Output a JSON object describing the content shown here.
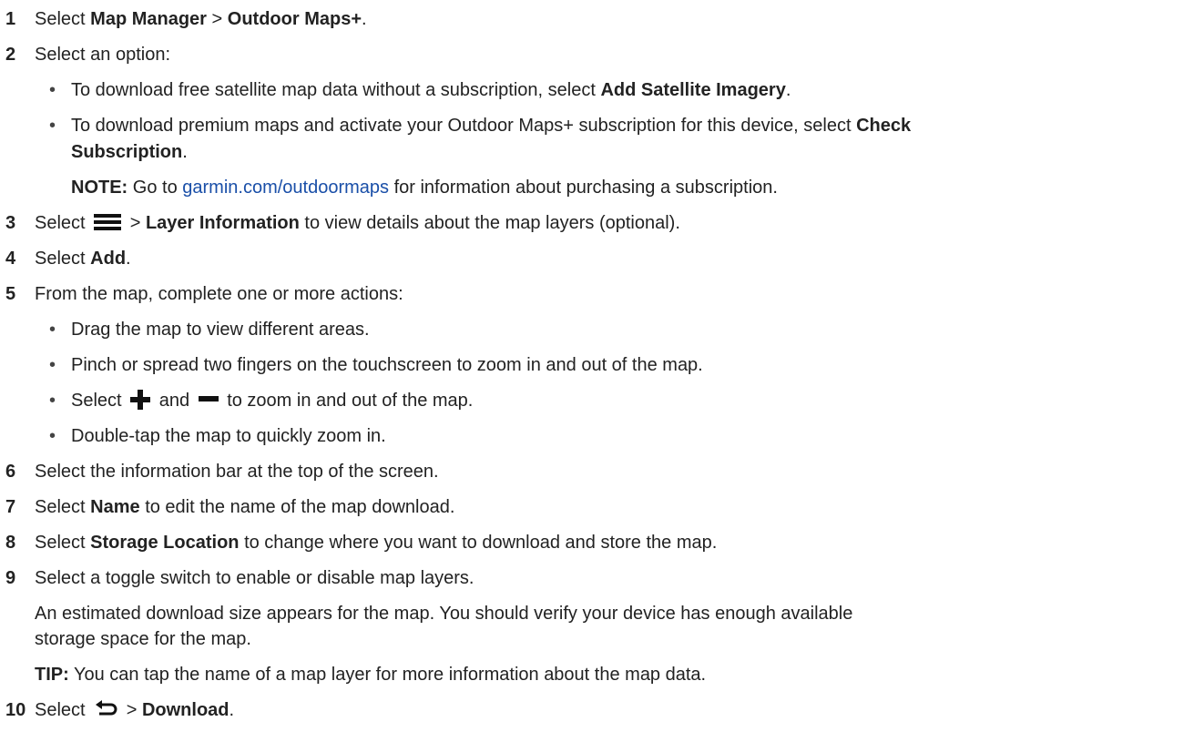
{
  "steps": [
    {
      "num": "1",
      "pre": "Select ",
      "b1": "Map Manager",
      "mid": " > ",
      "b2": "Outdoor Maps+",
      "post": "."
    },
    {
      "num": "2",
      "text": "Select an option:"
    },
    {
      "num": "3",
      "pre": "Select ",
      "mid": " > ",
      "b1": "Layer Information",
      "post": " to view details about the map layers (optional)."
    },
    {
      "num": "4",
      "pre": "Select ",
      "b1": "Add",
      "post": "."
    },
    {
      "num": "5",
      "text": "From the map, complete one or more actions:"
    },
    {
      "num": "6",
      "text": "Select the information bar at the top of the screen."
    },
    {
      "num": "7",
      "pre": "Select ",
      "b1": "Name",
      "post": " to edit the name of the map download."
    },
    {
      "num": "8",
      "pre": "Select ",
      "b1": "Storage Location",
      "post": " to change where you want to download and store the map."
    },
    {
      "num": "9",
      "text": "Select a toggle switch to enable or disable map layers."
    },
    {
      "num": "10",
      "pre": "Select ",
      "mid": " > ",
      "b1": "Download",
      "post": "."
    }
  ],
  "step2_bullets": {
    "b1_pre": "To download free satellite map data without a subscription, select ",
    "b1_bold": "Add Satellite Imagery",
    "b1_post": ".",
    "b2_pre": "To download premium maps and activate your Outdoor Maps+ subscription for this device, select ",
    "b2_bold1": "Check",
    "b2_bold2": "Subscription",
    "b2_post": "."
  },
  "note": {
    "label": "NOTE:",
    "pre": " Go to ",
    "link": "garmin.com/outdoormaps",
    "post": " for information about purchasing a subscription."
  },
  "step5_bullets": {
    "b1": "Drag the map to view different areas.",
    "b2": "Pinch or spread two fingers on the touchscreen to zoom in and out of the map.",
    "b3_pre": "Select ",
    "b3_mid": " and ",
    "b3_post": " to zoom in and out of the map.",
    "b4": "Double-tap the map to quickly zoom in."
  },
  "step9_extra": {
    "line1": "An estimated download size appears for the map. You should verify your device has enough available",
    "line2": "storage space for the map."
  },
  "tip": {
    "label": "TIP:",
    "text": " You can tap the name of a map layer for more information about the map data."
  },
  "bullet_char": "•",
  "colors": {
    "link": "#1a4fa8",
    "text": "#222222"
  },
  "icons": [
    "menu-icon",
    "plus-icon",
    "minus-icon",
    "back-icon"
  ]
}
